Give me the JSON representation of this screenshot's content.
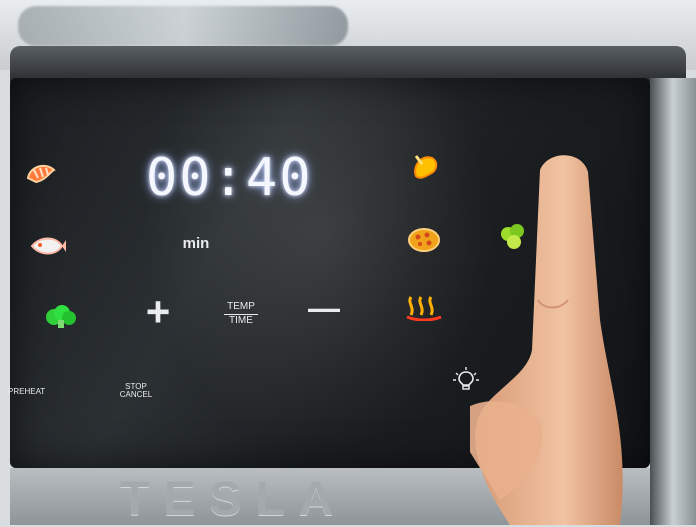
{
  "display": {
    "time": "00:40",
    "unit_label": "min"
  },
  "controls": {
    "plus_symbol": "+",
    "minus_symbol": "—",
    "temp_label": "TEMP",
    "time_label": "TIME",
    "stop_label": "STOP",
    "cancel_label": "CANCEL",
    "preheat_label": "PREHEAT"
  },
  "brand": {
    "name": "TESLA"
  },
  "icons": [
    "shrimp-icon",
    "fish-icon",
    "broccoli-icon",
    "chicken-leg-icon",
    "pizza-icon",
    "vegetables-icon",
    "heat-waves-icon",
    "light-bulb-icon"
  ],
  "colors": {
    "display_glow": "#9fb6ff",
    "heat_icon": "#ffb000",
    "broccoli": "#2fd03a",
    "panel": "#1c1f22"
  }
}
